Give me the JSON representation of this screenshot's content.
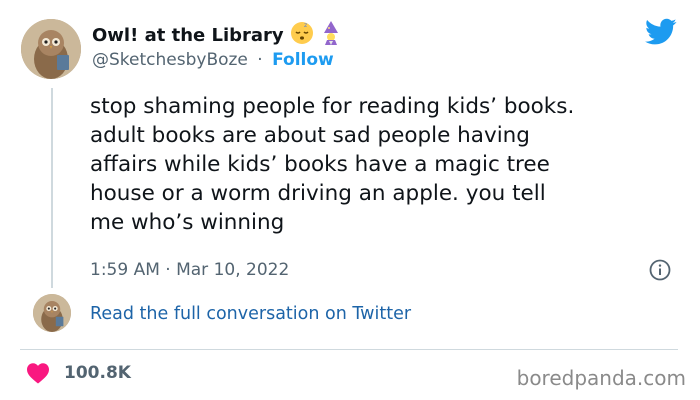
{
  "tweet": {
    "display_name": "Owl! at the Library",
    "handle": "@SketchesbyBoze",
    "separator": "·",
    "follow_label": "Follow",
    "text": "stop shaming people for reading kids’ books.\nadult books are about sad people having\naffairs while kids’ books have a magic tree\nhouse or a worm driving an apple. you tell\nme who’s winning",
    "timestamp": "1:59 AM · Mar 10, 2022",
    "read_full_label": "Read the full conversation on Twitter",
    "like_count": "100.8K",
    "name_emojis": [
      "sleeping-face-emoji",
      "wizard-emoji"
    ]
  },
  "watermark": "boredpanda.com",
  "colors": {
    "twitter_blue": "#1d9bf0",
    "link_blue": "#1d64a8",
    "text_primary": "#0f1419",
    "text_secondary": "#536471",
    "heart": "#f91880"
  }
}
